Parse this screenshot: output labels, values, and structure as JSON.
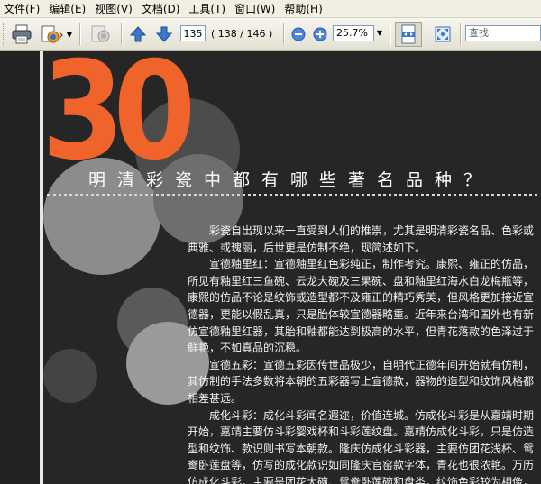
{
  "menu": [
    "文件(F)",
    "编辑(E)",
    "视图(V)",
    "文档(D)",
    "工具(T)",
    "窗口(W)",
    "帮助(H)"
  ],
  "toolbar": {
    "page_current": "135",
    "page_total": "( 138 / 146 )",
    "zoom": "25.7%",
    "search_placeholder": "查找"
  },
  "document": {
    "number": "30",
    "title": "明清彩瓷中都有哪些著名品种？",
    "paragraphs": [
      "彩瓷自出现以来一直受到人们的推崇，尤其是明清彩瓷名品、色彩或典雅、或瑰丽，后世更是仿制不绝，现简述如下。",
      "宣德釉里红：宣德釉里红色彩纯正，制作考究。康熙、雍正的仿品，所见有釉里红三鱼碗、云龙大碗及三果碗、盘和釉里红海水白龙梅瓶等，康熙的仿品不论是纹饰或造型都不及雍正的精巧秀美，但风格更加接近宣德器，更能以假乱真，只是胎体较宣德器略重。近年来台湾和国外也有新仿宣德釉里红器，其胎和釉都能达到极高的水平，但青花落款的色泽过于鲜艳，不如真品的沉稳。",
      "宣德五彩：宣德五彩因传世品极少，自明代正德年间开始就有仿制，其仿制的手法多数将本朝的五彩器写上宣德款，器物的造型和纹饰风格都相差甚远。",
      "成化斗彩：成化斗彩闻名遐迩，价值连城。仿成化斗彩是从嘉靖时期开始，嘉靖主要仿斗彩婴戏杯和斗彩莲纹盘。嘉靖仿成化斗彩，只是仿造型和纹饰、款识则书写本朝款。隆庆仿成化斗彩器，主要仿团花浅杯、鸳鸯卧莲盘等，仿写的成化款识如同隆庆官窑款字体，青花也很浓艳。万历仿成化斗彩，主要是团花大碗、鸳鸯卧莲碗和盘类，纹饰色彩较为相像，所署成化款"
    ]
  }
}
